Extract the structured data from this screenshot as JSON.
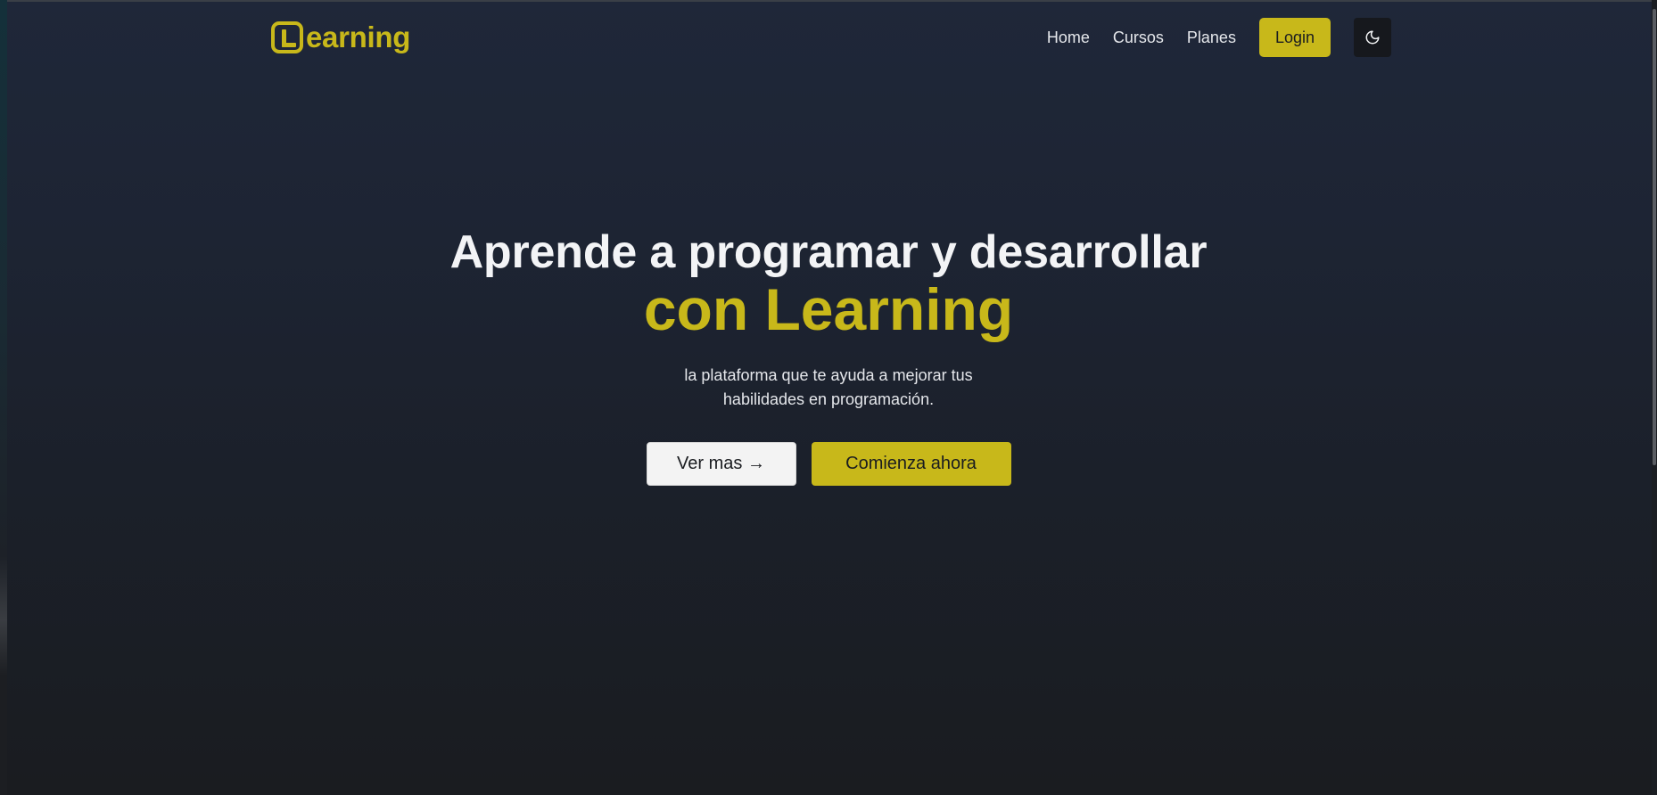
{
  "nav": {
    "logo_text": "earning",
    "links": [
      "Home",
      "Cursos",
      "Planes"
    ],
    "login_label": "Login"
  },
  "hero": {
    "title": "Aprende a programar y desarrollar",
    "accent": "con Learning",
    "subtitle": "la plataforma que te ayuda a mejorar tus habilidades en programación.",
    "secondary_button": "Ver mas →",
    "primary_button": "Comienza ahora"
  },
  "colors": {
    "accent": "#c8b81a",
    "background_top": "#1f2739",
    "background_bottom": "#1a1c20",
    "text": "#f3f4f6"
  },
  "icons": {
    "theme_toggle": "moon-icon"
  }
}
